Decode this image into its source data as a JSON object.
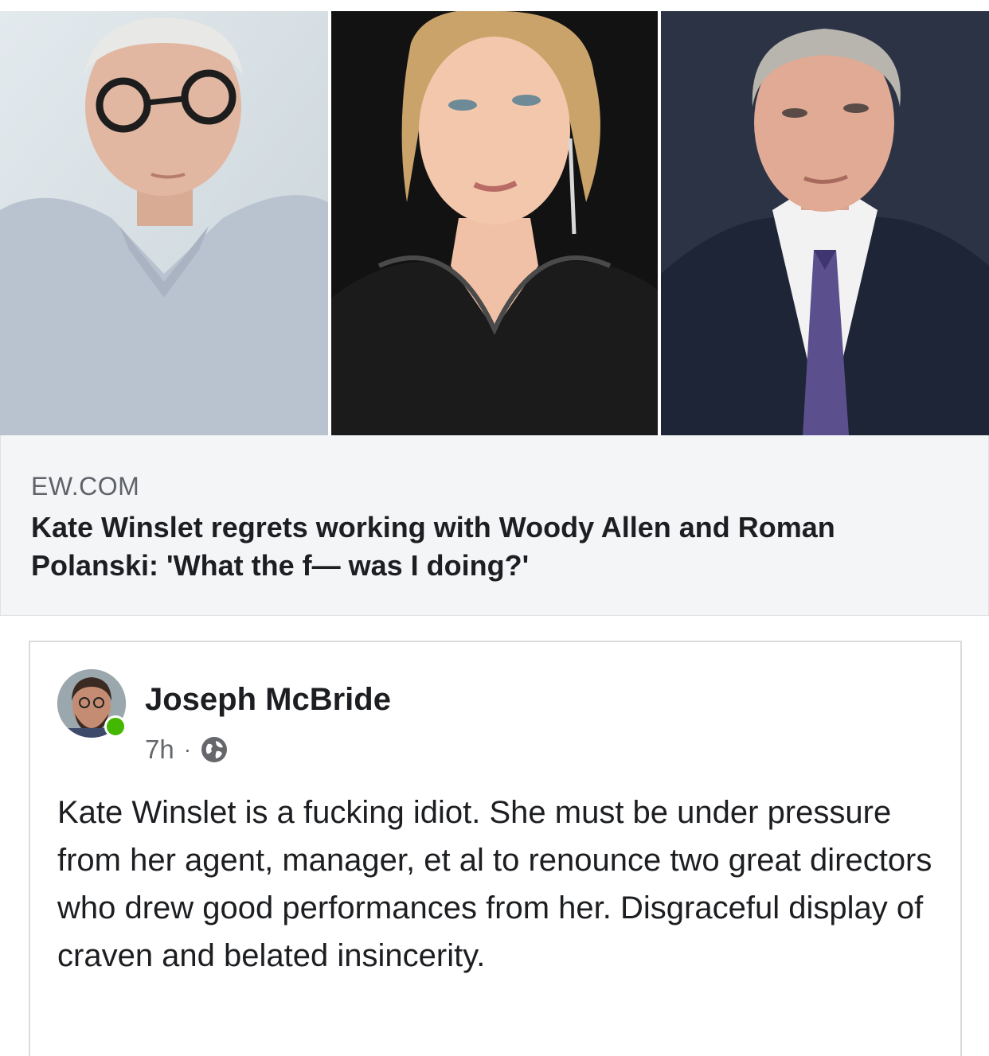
{
  "link_preview": {
    "domain": "EW.COM",
    "headline": "Kate Winslet regrets working with Woody Allen and Roman Polanski: 'What the f— was I doing?'",
    "photos": [
      "portrait-photo",
      "portrait-photo",
      "portrait-photo"
    ]
  },
  "post": {
    "author": "Joseph McBride",
    "time": "7h",
    "separator": "·",
    "privacy_icon": "globe-icon",
    "online_status_color": "#44b700",
    "text": "Kate Winslet is a fucking idiot. She must be under pressure from her agent, manager, et al to renounce two great directors who drew good performances from her. Disgraceful display of craven and belated insincerity."
  }
}
